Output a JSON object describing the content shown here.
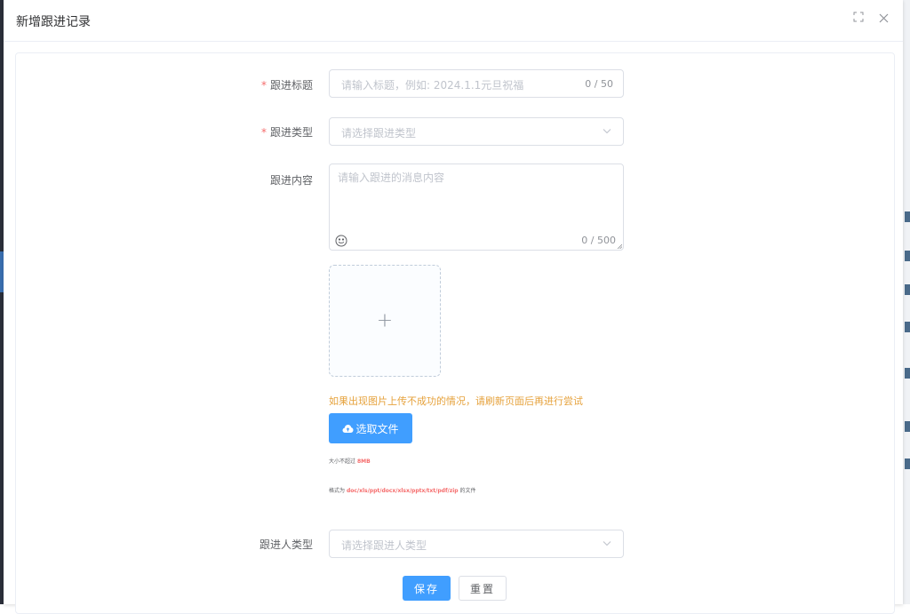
{
  "dialog": {
    "title": "新增跟进记录",
    "fullscreen_icon": "fullscreen-icon",
    "close_icon": "close-icon"
  },
  "form": {
    "title_field": {
      "label": "跟进标题",
      "required": true,
      "placeholder": "请输入标题，例如: 2024.1.1元旦祝福",
      "count": "0 / 50"
    },
    "type_field": {
      "label": "跟进类型",
      "required": true,
      "placeholder": "请选择跟进类型"
    },
    "content_field": {
      "label": "跟进内容",
      "placeholder": "请输入跟进的消息内容",
      "count": "0 / 500",
      "emoji_icon": "smile-icon"
    },
    "image_upload": {
      "icon": "plus-icon",
      "plus_glyph": "+"
    },
    "upload_warning": "如果出现图片上传不成功的情况，请刷新页面后再进行尝试",
    "file_button": {
      "label": "选取文件",
      "icon": "cloud-upload-icon"
    },
    "size_tip": {
      "prefix": "大小不超过",
      "value": "8MB"
    },
    "format_tip": {
      "prefix": "格式为",
      "value": "doc/xls/ppt/docx/xlsx/pptx/txt/pdf/zip",
      "suffix": "的文件"
    },
    "person_type_field": {
      "label": "跟进人类型",
      "placeholder": "请选择跟进人类型"
    }
  },
  "actions": {
    "save": "保存",
    "reset": "重置"
  },
  "colors": {
    "primary": "#409eff",
    "required": "#f56c6c",
    "warning": "#e6a23c"
  }
}
